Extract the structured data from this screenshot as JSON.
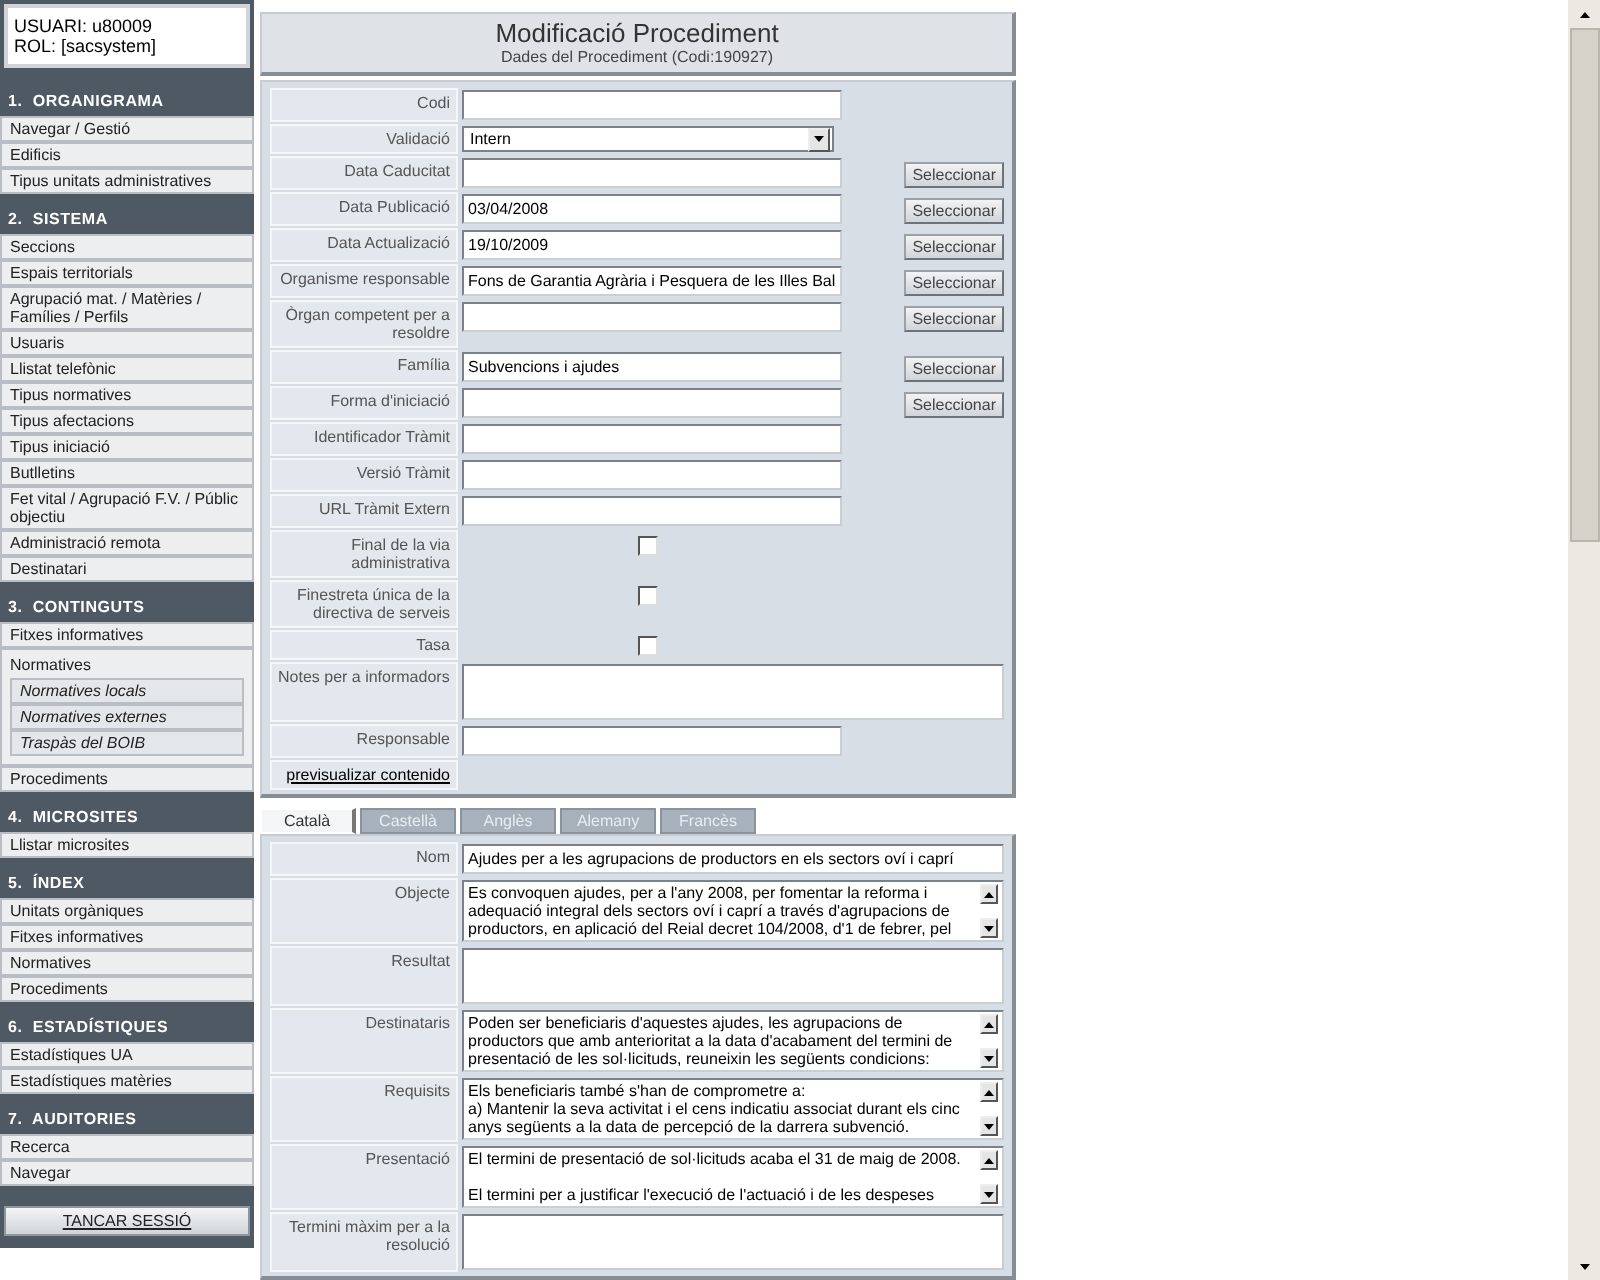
{
  "user": {
    "lines": [
      "USUARI: u80009",
      "ROL: [sacsystem]"
    ]
  },
  "sidebar": {
    "sections": [
      {
        "title": "1.  ORGANIGRAMA",
        "items": [
          {
            "label": "Navegar / Gestió"
          },
          {
            "label": "Edificis"
          },
          {
            "label": "Tipus unitats administratives"
          }
        ]
      },
      {
        "title": "2.  SISTEMA",
        "items": [
          {
            "label": "Seccions"
          },
          {
            "label": "Espais territorials"
          },
          {
            "label": "Agrupació mat. / Matèries / Famílies / Perfils"
          },
          {
            "label": "Usuaris"
          },
          {
            "label": "Llistat telefònic"
          },
          {
            "label": "Tipus normatives"
          },
          {
            "label": "Tipus afectacions"
          },
          {
            "label": "Tipus iniciació"
          },
          {
            "label": "Butlletins"
          },
          {
            "label": "Fet vital / Agrupació F.V. / Públic objectiu"
          },
          {
            "label": "Administració remota"
          },
          {
            "label": "Destinatari"
          }
        ]
      },
      {
        "title": "3.  CONTINGUTS",
        "items": [
          {
            "label": "Fitxes informatives"
          },
          {
            "label": "Normatives",
            "children": [
              {
                "label": "Normatives locals"
              },
              {
                "label": "Normatives externes"
              },
              {
                "label": "Traspàs del BOIB"
              }
            ]
          },
          {
            "label": "Procediments"
          }
        ]
      },
      {
        "title": "4.  MICROSITES",
        "items": [
          {
            "label": "Llistar microsites"
          }
        ]
      },
      {
        "title": "5.  ÍNDEX",
        "items": [
          {
            "label": "Unitats orgàniques"
          },
          {
            "label": "Fitxes informatives"
          },
          {
            "label": "Normatives"
          },
          {
            "label": "Procediments"
          }
        ]
      },
      {
        "title": "6.  ESTADÍSTIQUES",
        "items": [
          {
            "label": "Estadístiques UA"
          },
          {
            "label": "Estadístiques matèries"
          }
        ]
      },
      {
        "title": "7.  AUDITORIES",
        "items": [
          {
            "label": "Recerca"
          },
          {
            "label": "Navegar"
          }
        ]
      }
    ],
    "logout": "TANCAR SESSIÓ"
  },
  "header": {
    "title": "Modificació Procediment",
    "subtitle": "Dades del Procediment  (Codi:190927)"
  },
  "form": {
    "rows": [
      {
        "kind": "input",
        "label": "Codi"
      },
      {
        "kind": "select",
        "label": "Validació",
        "value": "Intern"
      },
      {
        "kind": "input",
        "label": "Data Caducitat",
        "button": "Seleccionar"
      },
      {
        "kind": "input",
        "label": "Data Publicació",
        "value": "03/04/2008",
        "button": "Seleccionar"
      },
      {
        "kind": "input",
        "label": "Data Actualizació",
        "value": "19/10/2009",
        "button": "Seleccionar"
      },
      {
        "kind": "input",
        "label": "Organisme responsable",
        "value": "Fons de Garantia Agrària i Pesquera de les Illes Bal",
        "button": "Seleccionar"
      },
      {
        "kind": "input",
        "label": "Òrgan competent per a resoldre",
        "button": "Seleccionar"
      },
      {
        "kind": "input",
        "label": "Família",
        "value": "Subvencions i ajudes",
        "button": "Seleccionar"
      },
      {
        "kind": "input",
        "label": "Forma d'iniciació",
        "button": "Seleccionar"
      },
      {
        "kind": "input",
        "label": "Identificador Tràmit"
      },
      {
        "kind": "input",
        "label": "Versió Tràmit"
      },
      {
        "kind": "input",
        "label": "URL Tràmit Extern"
      },
      {
        "kind": "checkbox",
        "label": "Final de la via administrativa",
        "checked": false
      },
      {
        "kind": "checkbox",
        "label": "Finestreta única de la directiva de serveis",
        "checked": false
      },
      {
        "kind": "checkbox",
        "label": "Tasa",
        "checked": false
      },
      {
        "kind": "textarea",
        "label": "Notes per a informadors"
      },
      {
        "kind": "input",
        "label": "Responsable"
      },
      {
        "kind": "link",
        "label": "previsualizar contenido"
      }
    ]
  },
  "tabs": [
    {
      "label": "Català",
      "selected": true
    },
    {
      "label": "Castellà",
      "selected": false
    },
    {
      "label": "Anglès",
      "selected": false
    },
    {
      "label": "Alemany",
      "selected": false
    },
    {
      "label": "Francès",
      "selected": false
    }
  ],
  "translations": {
    "rows": [
      {
        "kind": "input",
        "label": "Nom",
        "value": "Ajudes per a les agrupacions de productors en els sectors oví i caprí"
      },
      {
        "kind": "textarea",
        "label": "Objecte",
        "value": "Es convoquen ajudes, per a l'any 2008, per fomentar la reforma i\nadequació integral dels sectors oví i caprí a través d'agrupacions de\nproductors, en aplicació del Reial decret 104/2008, d'1 de febrer, pel",
        "scrollable": true
      },
      {
        "kind": "textarea",
        "label": "Resultat",
        "scrollable": false
      },
      {
        "kind": "textarea",
        "label": "Destinataris",
        "value": "Poden ser beneficiaris d'aquestes ajudes, les agrupacions de\nproductors que amb anterioritat a la data d'acabament del termini de\npresentació de les sol·licituds, reuneixin les següents condicions:",
        "scrollable": true
      },
      {
        "kind": "textarea",
        "label": "Requisits",
        "value": "Els beneficiaris també s'han de comprometre a:\na) Mantenir la seva activitat i el cens indicatiu associat durant els cinc\nanys següents a la data de percepció de la darrera subvenció.",
        "scrollable": true
      },
      {
        "kind": "textarea",
        "label": "Presentació",
        "value": "El termini de presentació de sol·licituds acaba el 31 de maig de 2008.\n\nEl termini per a justificar l'execució de l'actuació i de les despeses",
        "scrollable": true
      },
      {
        "kind": "textarea",
        "label": "Termini màxim per a la resolució",
        "scrollable": false
      }
    ]
  }
}
